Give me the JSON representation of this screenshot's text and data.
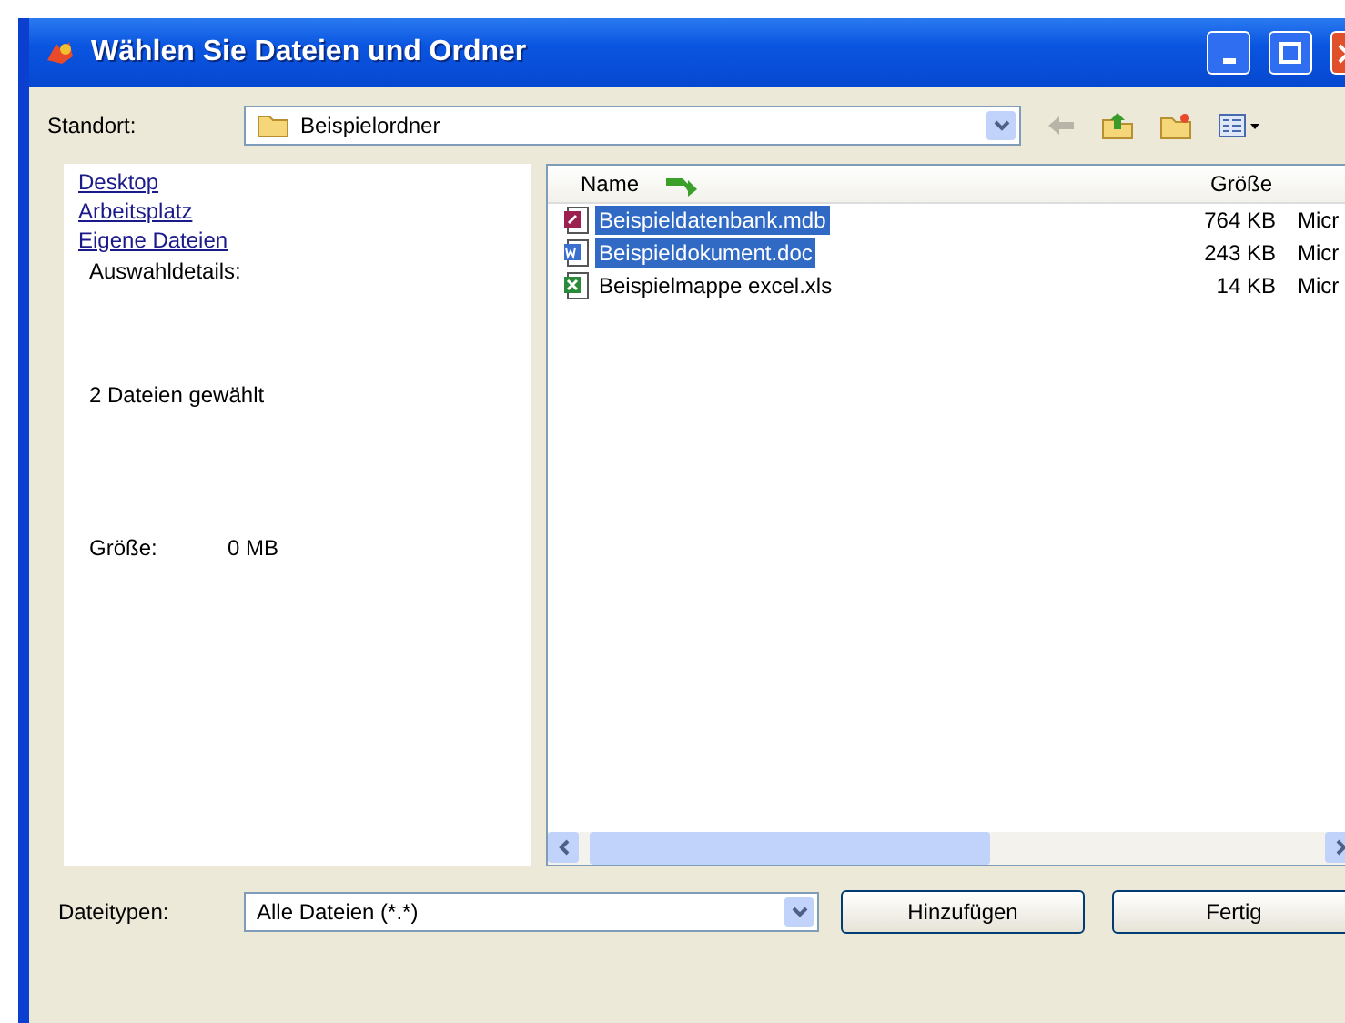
{
  "window": {
    "title": "Wählen Sie Dateien und Ordner"
  },
  "location": {
    "label": "Standort:",
    "value": "Beispielordner"
  },
  "links": [
    "Desktop",
    "Arbeitsplatz",
    "Eigene Dateien"
  ],
  "details": {
    "heading": "Auswahldetails:",
    "count": "2 Dateien gewählt",
    "size_label": "Größe:",
    "size_value": "0 MB"
  },
  "file_list": {
    "columns": [
      "Name",
      "Größe"
    ],
    "rows": [
      {
        "name": "Beispieldatenbank.mdb",
        "size": "764 KB",
        "column_3": "Micr",
        "kind": "database",
        "selected": true
      },
      {
        "name": "Beispieldokument.doc",
        "size": "243 KB",
        "column_3": "Micr",
        "kind": "document",
        "selected": true
      },
      {
        "name": "Beispielmappe excel.xls",
        "size": "14 KB",
        "column_3": "Micr",
        "kind": "spreadsheet",
        "selected": false
      }
    ]
  },
  "file_types": {
    "label": "Dateitypen:",
    "value": "Alle Dateien (*.*)"
  },
  "buttons": [
    "Hinzufügen",
    "Fertig"
  ]
}
